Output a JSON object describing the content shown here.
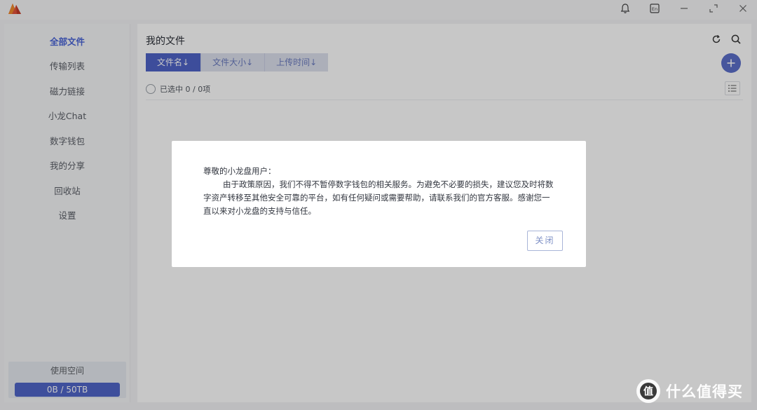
{
  "window": {
    "icons": [
      "bell-icon",
      "language-en-icon",
      "minimize-icon",
      "maximize-icon",
      "close-icon"
    ],
    "language_badge": "En"
  },
  "sidebar": {
    "items": [
      {
        "label": "全部文件",
        "active": true
      },
      {
        "label": "传输列表"
      },
      {
        "label": "磁力链接"
      },
      {
        "label": "小龙Chat"
      },
      {
        "label": "数字钱包"
      },
      {
        "label": "我的分享"
      },
      {
        "label": "回收站"
      },
      {
        "label": "设置"
      }
    ],
    "storage": {
      "title": "使用空间",
      "usage_text": "0B / 50TB",
      "used_fraction": 1.0
    }
  },
  "main": {
    "title": "我的文件",
    "sort_tabs": [
      {
        "label": "文件名↓",
        "active": true
      },
      {
        "label": "文件大小↓"
      },
      {
        "label": "上传时间↓"
      }
    ],
    "selection_label": "已选中 0 / 0项"
  },
  "dialog": {
    "greeting": "尊敬的小龙盘用户：",
    "body": "由于政策原因，我们不得不暂停数字钱包的相关服务。为避免不必要的损失，建议您及时将数字资产转移至其他安全可靠的平台，如有任何疑问或需要帮助，请联系我们的官方客服。感谢您一直以来对小龙盘的支持与信任。",
    "close_label": "关闭"
  },
  "watermark": {
    "logo_char": "值",
    "text": "什么值得买"
  },
  "colors": {
    "accent": "#4f63c7",
    "accent_light": "#dde1ee",
    "active_nav": "#4a64d6"
  }
}
